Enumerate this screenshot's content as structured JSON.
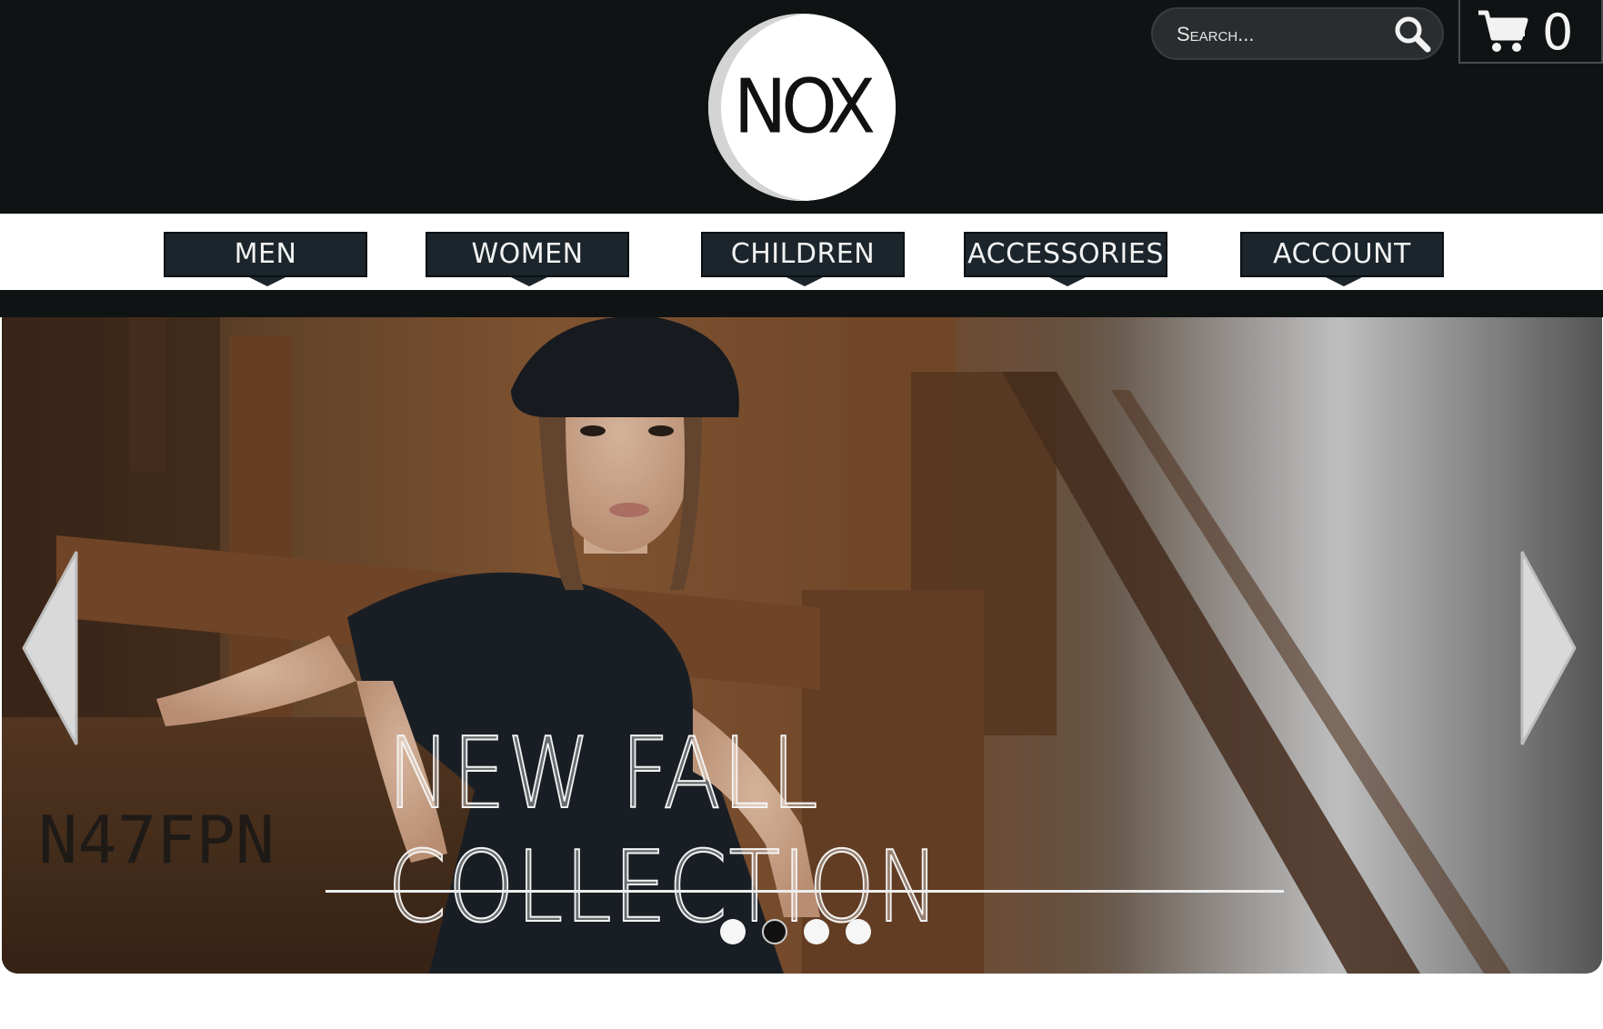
{
  "header": {
    "logo_text": "NOX",
    "search": {
      "placeholder": "Search..."
    },
    "cart": {
      "count": "0"
    }
  },
  "nav": {
    "items": [
      {
        "label": "MEN"
      },
      {
        "label": "WOMEN"
      },
      {
        "label": "CHILDREN"
      },
      {
        "label": "ACCESSORIES"
      },
      {
        "label": "ACCOUNT"
      }
    ]
  },
  "hero": {
    "title": "NEW FALL COLLECTION",
    "slides": 4,
    "active_slide": 2
  },
  "icons": {
    "search": "search-icon",
    "cart": "cart-icon",
    "prev": "chevron-left-icon",
    "next": "chevron-right-icon"
  },
  "colors": {
    "header_bg": "#101314",
    "nav_item_bg": "#1b252b",
    "page_bg": "#ffffff"
  }
}
